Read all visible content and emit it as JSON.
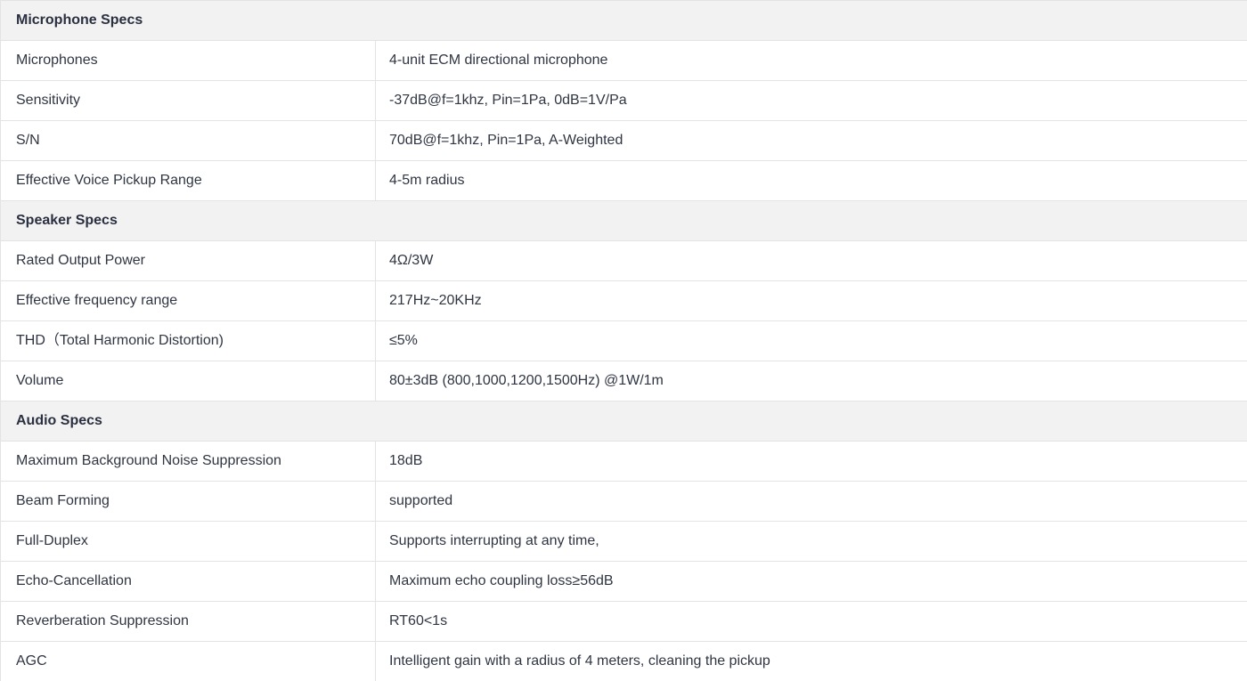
{
  "sections": [
    {
      "title": "Microphone Specs",
      "rows": [
        {
          "label": "Microphones",
          "value": "4-unit ECM directional microphone"
        },
        {
          "label": "Sensitivity",
          "value": "-37dB@f=1khz, Pin=1Pa, 0dB=1V/Pa"
        },
        {
          "label": "S/N",
          "value": "70dB@f=1khz, Pin=1Pa, A-Weighted"
        },
        {
          "label": "Effective Voice Pickup Range",
          "value": "4-5m radius"
        }
      ]
    },
    {
      "title": "Speaker Specs",
      "rows": [
        {
          "label": "Rated Output Power",
          "value": "4Ω/3W"
        },
        {
          "label": "Effective frequency range",
          "value": "217Hz~20KHz"
        },
        {
          "label": "THD（Total Harmonic Distortion)",
          "value": "≤5%"
        },
        {
          "label": "Volume",
          "value": "80±3dB (800,1000,1200,1500Hz) @1W/1m"
        }
      ]
    },
    {
      "title": "Audio Specs",
      "rows": [
        {
          "label": "Maximum Background Noise Suppression",
          "value": "18dB"
        },
        {
          "label": "Beam Forming",
          "value": "supported"
        },
        {
          "label": "Full-Duplex",
          "value": "Supports interrupting at any time,"
        },
        {
          "label": "Echo-Cancellation",
          "value": "Maximum echo coupling loss≥56dB"
        },
        {
          "label": "Reverberation Suppression",
          "value": "RT60<1s"
        },
        {
          "label": "AGC",
          "value": "Intelligent gain with a radius of 4 meters, cleaning the pickup"
        }
      ]
    }
  ]
}
